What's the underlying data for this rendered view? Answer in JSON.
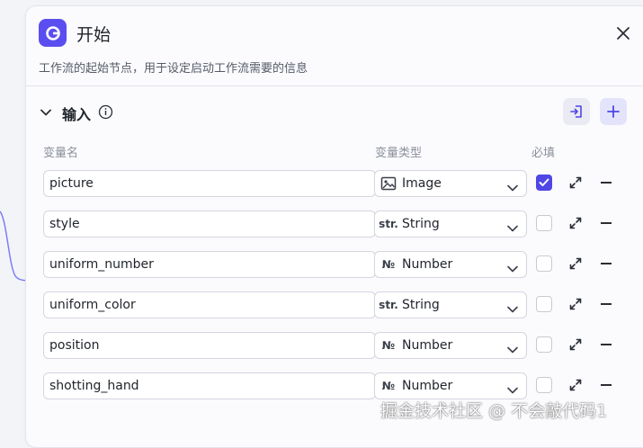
{
  "node": {
    "title": "开始",
    "description": "工作流的起始节点，用于设定启动工作流需要的信息"
  },
  "section": {
    "title": "输入"
  },
  "columns": {
    "name": "变量名",
    "type": "变量类型",
    "required": "必填"
  },
  "variables": [
    {
      "name": "picture",
      "type": "Image",
      "type_icon": "image-icon",
      "required": true
    },
    {
      "name": "style",
      "type": "String",
      "type_icon": "str.",
      "required": false
    },
    {
      "name": "uniform_number",
      "type": "Number",
      "type_icon": "№",
      "required": false
    },
    {
      "name": "uniform_color",
      "type": "String",
      "type_icon": "str.",
      "required": false
    },
    {
      "name": "position",
      "type": "Number",
      "type_icon": "№",
      "required": false
    },
    {
      "name": "shotting_hand",
      "type": "Number",
      "type_icon": "№",
      "required": false
    }
  ],
  "watermark": "掘金技术社区 @ 不会敲代码1",
  "colors": {
    "accent": "#4f46e5",
    "logo_bg": "#5a4ef0",
    "curve": "#7b7ff0"
  }
}
